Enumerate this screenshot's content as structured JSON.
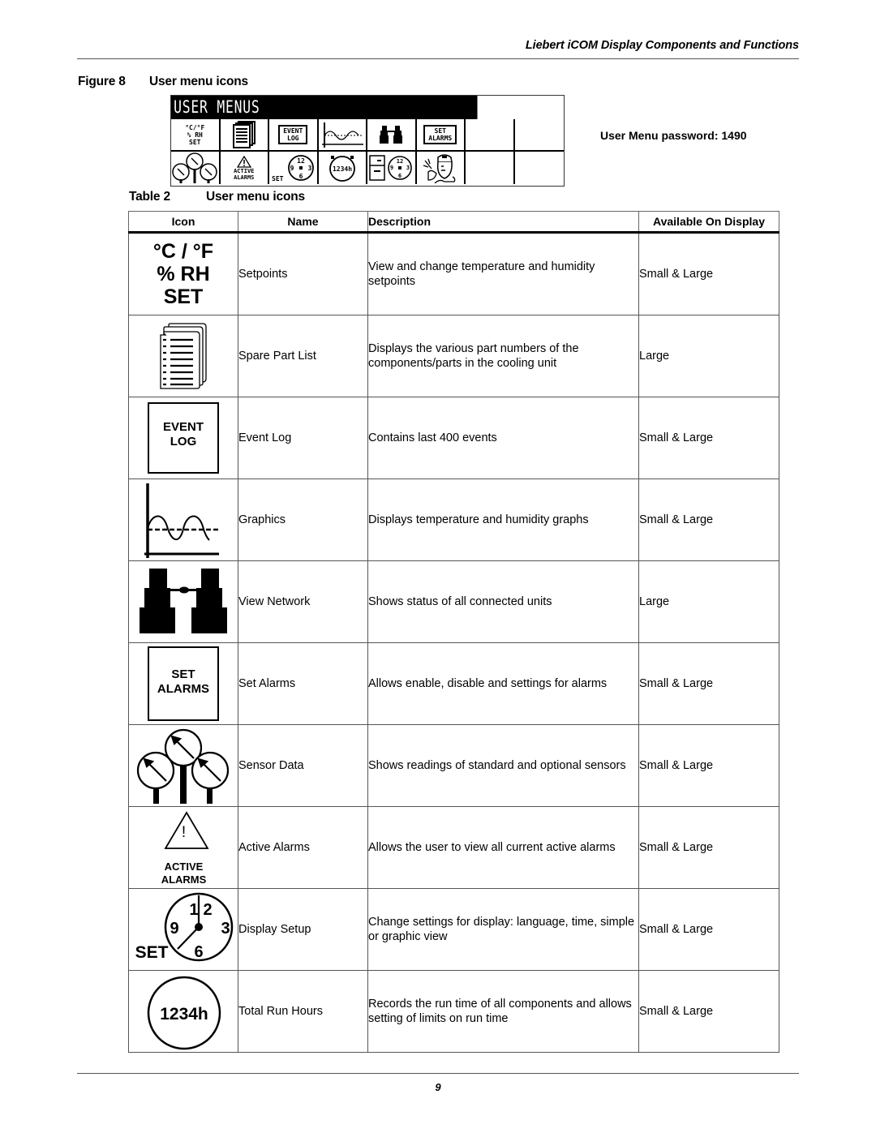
{
  "header": {
    "running_title": "Liebert iCOM Display Components and Functions"
  },
  "figure": {
    "number": "Figure 8",
    "title": "User menu icons",
    "lcd_title": "USER MENUS",
    "row1": [
      {
        "icon": "setpoints-icon",
        "lines": [
          "°C/°F",
          "% RH",
          "SET"
        ]
      },
      {
        "icon": "spare-part-list-icon"
      },
      {
        "icon": "event-log-icon",
        "lines": [
          "EVENT",
          "LOG"
        ]
      },
      {
        "icon": "graphics-icon"
      },
      {
        "icon": "view-network-icon"
      },
      {
        "icon": "set-alarms-icon",
        "lines": [
          "SET",
          "ALARMS"
        ]
      },
      {
        "icon": "empty"
      },
      {
        "icon": "empty"
      }
    ],
    "row2": [
      {
        "icon": "sensor-data-icon"
      },
      {
        "icon": "active-alarms-icon",
        "lines": [
          "ACTIVE",
          "ALARMS"
        ]
      },
      {
        "icon": "display-setup-icon",
        "lines": [
          "SET"
        ]
      },
      {
        "icon": "total-run-hours-icon",
        "lines": [
          "1234h"
        ]
      },
      {
        "icon": "service-contacts-icon"
      },
      {
        "icon": "technician-icon"
      },
      {
        "icon": "empty"
      },
      {
        "icon": "empty"
      }
    ],
    "password_label": "User Menu password: 1490"
  },
  "table": {
    "number": "Table 2",
    "title": "User menu icons",
    "columns": [
      "Icon",
      "Name",
      "Description",
      "Available On Display"
    ],
    "rows": [
      {
        "icon": "setpoints-icon",
        "icon_text": [
          "°C / °F",
          "% RH",
          "SET"
        ],
        "name": "Setpoints",
        "description": "View and change temperature and humidity setpoints",
        "display": "Small & Large"
      },
      {
        "icon": "spare-part-list-icon",
        "name": "Spare Part List",
        "description": "Displays the various part numbers of the components/parts in the cooling unit",
        "display": "Large"
      },
      {
        "icon": "event-log-icon",
        "icon_text": [
          "EVENT",
          "LOG"
        ],
        "name": "Event Log",
        "description": "Contains last 400 events",
        "display": "Small & Large"
      },
      {
        "icon": "graphics-icon",
        "name": "Graphics",
        "description": "Displays temperature and humidity graphs",
        "display": "Small & Large"
      },
      {
        "icon": "binoculars-icon",
        "name": "View Network",
        "description": "Shows status of all connected units",
        "display": "Large"
      },
      {
        "icon": "set-alarms-icon",
        "icon_text": [
          "SET",
          "ALARMS"
        ],
        "name": "Set Alarms",
        "description": "Allows enable, disable and settings for alarms",
        "display": "Small & Large"
      },
      {
        "icon": "gauges-icon",
        "name": "Sensor Data",
        "description": "Shows readings of standard and optional sensors",
        "display": "Small & Large"
      },
      {
        "icon": "warning-triangle-icon",
        "icon_text": [
          "!",
          "ACTIVE",
          "ALARMS"
        ],
        "name": "Active Alarms",
        "description": "Allows the user to view all current active alarms",
        "display": "Small & Large"
      },
      {
        "icon": "clock-icon",
        "icon_text": [
          "1",
          "2",
          "9",
          "3",
          "6",
          "SET"
        ],
        "name": "Display Setup",
        "description": "Change settings for display: language, time, simple or graphic view",
        "display": "Small & Large"
      },
      {
        "icon": "run-hours-icon",
        "icon_text": [
          "1234h"
        ],
        "name": "Total Run Hours",
        "description": "Records the run time of all components and allows setting of limits on run time",
        "display": "Small & Large"
      }
    ]
  },
  "footer": {
    "page_number": "9"
  }
}
